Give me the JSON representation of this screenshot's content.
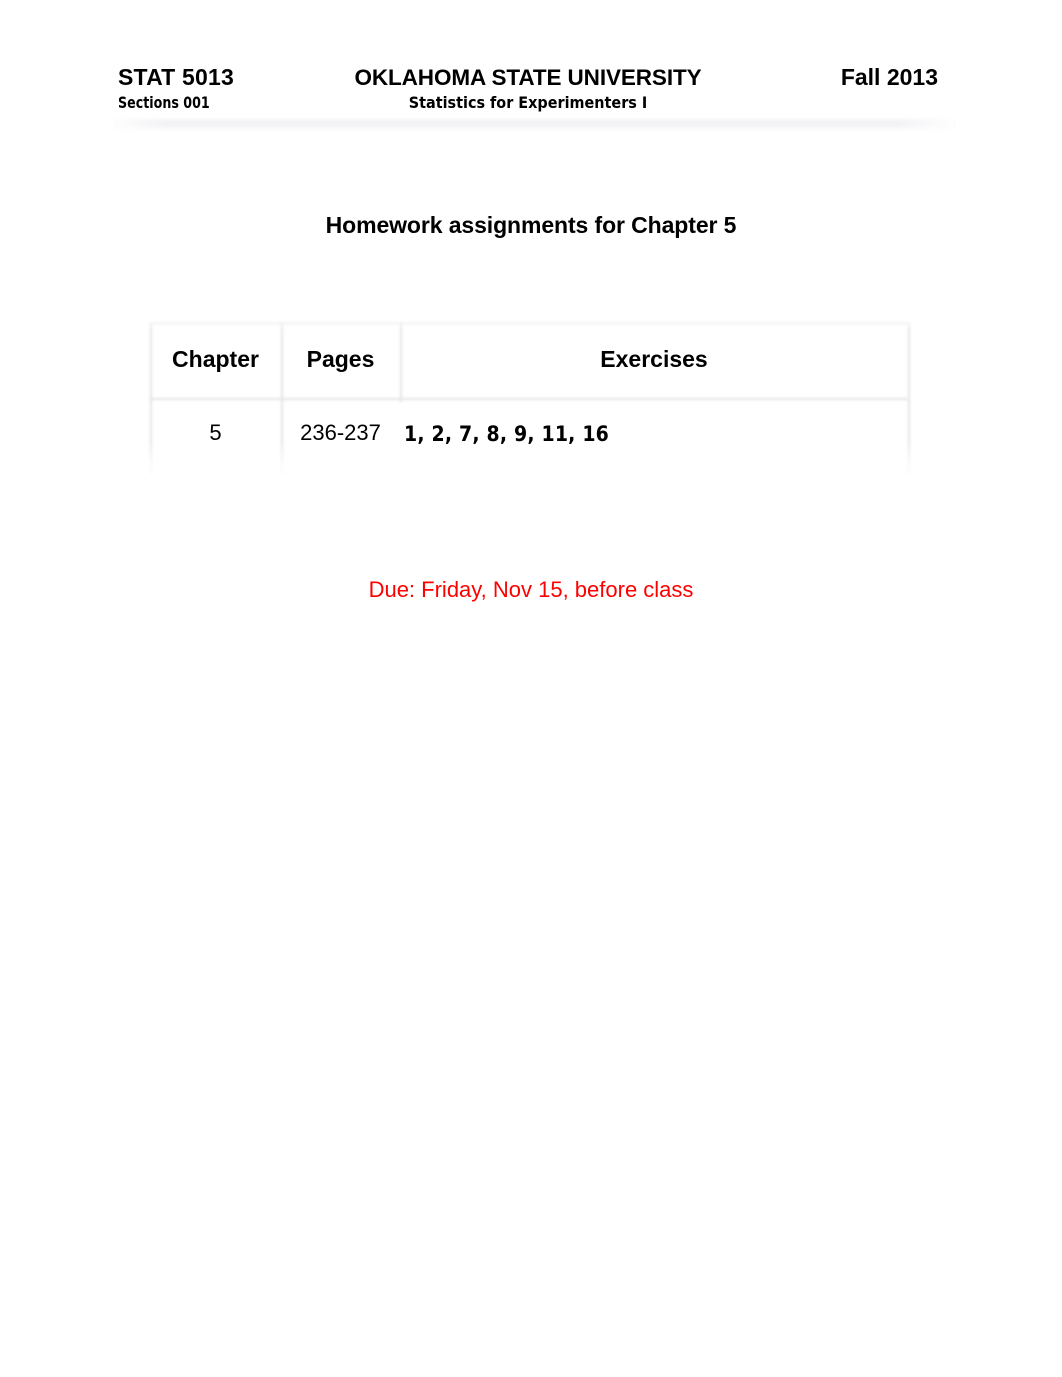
{
  "header": {
    "course_code": "STAT 5013",
    "university": "OKLAHOMA STATE UNIVERSITY",
    "term": "Fall 2013",
    "sections": "Sections 001",
    "course_title": "Statistics for Experimenters I"
  },
  "title": "Homework assignments for Chapter 5",
  "table": {
    "columns": [
      "Chapter",
      "Pages",
      "Exercises"
    ],
    "rows": [
      {
        "chapter": "5",
        "pages": "236-237",
        "exercises": "1, 2, 7, 8, 9, 11, 16"
      }
    ]
  },
  "due": {
    "text": "Due: Friday, Nov 15, before class",
    "color": "#ff0000"
  }
}
